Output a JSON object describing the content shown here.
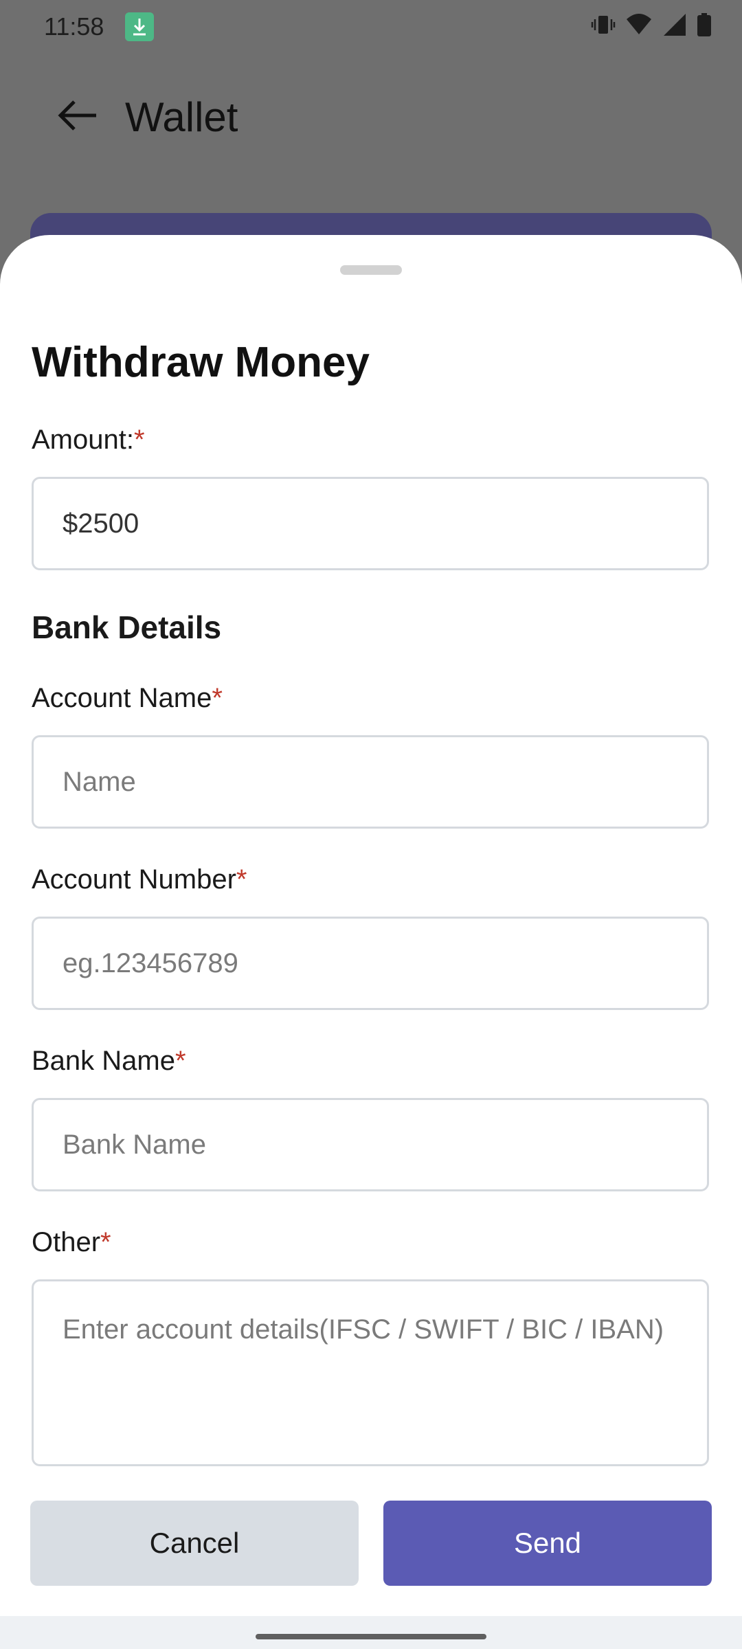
{
  "status": {
    "time": "11:58",
    "icons": [
      "download-notification-icon",
      "vibrate-icon",
      "wifi-icon",
      "signal-icon",
      "battery-icon"
    ]
  },
  "appbar": {
    "title": "Wallet",
    "back_icon": "arrow-left-icon"
  },
  "sheet": {
    "title": "Withdraw Money",
    "amount": {
      "label": "Amount:",
      "required": "*",
      "value": "$2500"
    },
    "bank_section_title": "Bank Details",
    "account_name": {
      "label": "Account Name",
      "required": "*",
      "placeholder": "Name"
    },
    "account_number": {
      "label": "Account Number",
      "required": "*",
      "placeholder": "eg.123456789"
    },
    "bank_name": {
      "label": "Bank Name",
      "required": "*",
      "placeholder": "Bank Name"
    },
    "other": {
      "label": "Other",
      "required": "*",
      "placeholder": "Enter account details(IFSC / SWIFT / BIC / IBAN)"
    },
    "cancel_label": "Cancel",
    "send_label": "Send"
  },
  "colors": {
    "accent": "#5b5bb4",
    "required": "#c0392b",
    "cancel_bg": "#d8dde3",
    "scrim": "#6f6f6f"
  }
}
